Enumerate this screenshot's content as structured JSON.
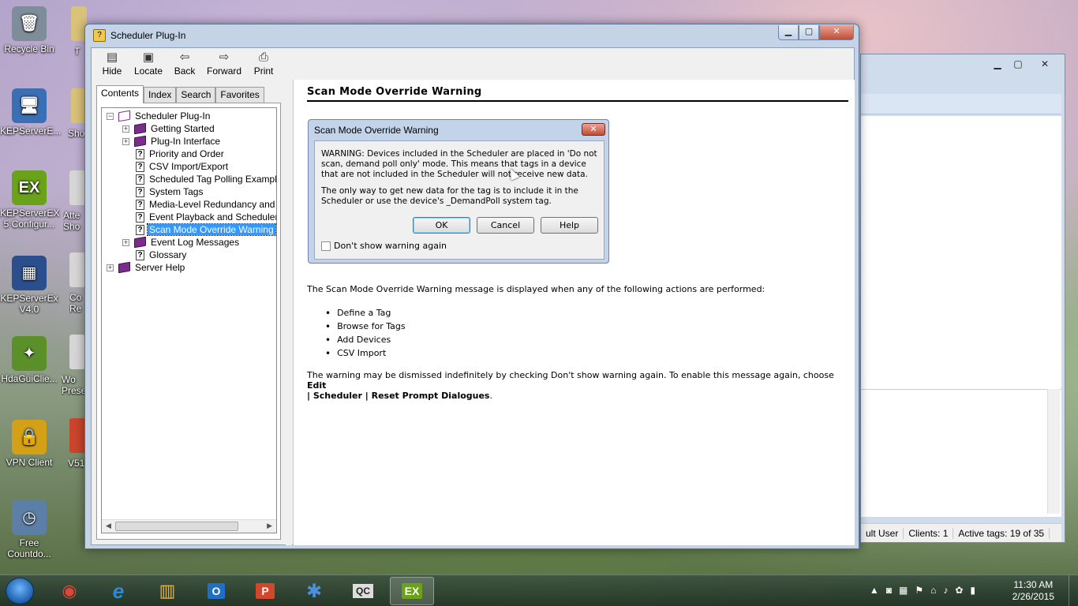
{
  "desktop": {
    "icons": [
      {
        "label": "Recycle Bin",
        "color": "#7f8c99",
        "glyph": "🗑"
      },
      {
        "label": "KEPServerE...",
        "color": "#3b6fb3",
        "glyph": "🖥"
      },
      {
        "label": "KEPServerEX 5 Configur...",
        "color": "#6aa21a",
        "glyph": "EX"
      },
      {
        "label": "KEPServerEx V4.0",
        "color": "#2b4f8c",
        "glyph": "▦"
      },
      {
        "label": "HdaGuiClie...",
        "color": "#5a8f2a",
        "glyph": "✦"
      },
      {
        "label": "VPN Client",
        "color": "#d4a017",
        "glyph": "🔒"
      },
      {
        "label": "Free Countdo...",
        "color": "#5b7fa6",
        "glyph": "◷"
      }
    ],
    "partial_labels": [
      "T",
      "Sho",
      "Atte Sho",
      "Co Re",
      "Wo Prese",
      "V51"
    ]
  },
  "background_window": {
    "status": [
      "ult User",
      "Clients: 1",
      "Active tags: 19 of 35"
    ]
  },
  "help_window": {
    "title": "Scheduler Plug-In",
    "caption": {
      "minimize": "▁",
      "maximize": "▢",
      "close": "✕"
    },
    "toolbar": [
      {
        "label": "Hide",
        "icon": "hide-icon",
        "glyph": "▤"
      },
      {
        "label": "Locate",
        "icon": "locate-icon",
        "glyph": "▣"
      },
      {
        "label": "Back",
        "icon": "back-arrow-icon",
        "glyph": "⇦"
      },
      {
        "label": "Forward",
        "icon": "forward-arrow-icon",
        "glyph": "⇨"
      },
      {
        "label": "Print",
        "icon": "printer-icon",
        "glyph": "⎙"
      }
    ],
    "tabs": [
      "Contents",
      "Index",
      "Search",
      "Favorites"
    ],
    "tree": [
      {
        "label": "Scheduler Plug-In",
        "type": "book-open",
        "expander": "−"
      },
      {
        "label": "Getting Started",
        "type": "book",
        "expander": "+"
      },
      {
        "label": "Plug-In Interface",
        "type": "book",
        "expander": "+"
      },
      {
        "label": "Priority and Order",
        "type": "page"
      },
      {
        "label": "CSV Import/Export",
        "type": "page"
      },
      {
        "label": "Scheduled Tag Polling Examples",
        "type": "page"
      },
      {
        "label": "System Tags",
        "type": "page"
      },
      {
        "label": "Media-Level Redundancy and Sc",
        "type": "page"
      },
      {
        "label": "Event Playback and Scheduler",
        "type": "page"
      },
      {
        "label": "Scan Mode Override Warning",
        "type": "page",
        "selected": true
      },
      {
        "label": "Event Log Messages",
        "type": "book",
        "expander": "+"
      },
      {
        "label": "Glossary",
        "type": "page"
      },
      {
        "label": "Server Help",
        "type": "book",
        "expander": "+"
      }
    ],
    "content": {
      "heading": "Scan Mode Override Warning",
      "dialog": {
        "title": "Scan Mode Override Warning",
        "close": "✕",
        "warning": "WARNING: Devices included in the Scheduler are placed in 'Do not scan, demand poll only' mode. This means that tags in a device that are not included in the Scheduler will not receive new data.",
        "info": "The only way to get new data for the tag is to include it in the Scheduler or use the device's _DemandPoll system tag.",
        "ok": "OK",
        "cancel": "Cancel",
        "help": "Help",
        "checkbox": "Don't show warning again"
      },
      "intro": "The Scan Mode Override Warning message is displayed when any of the following actions are performed:",
      "actions": [
        "Define a Tag",
        "Browse for Tags",
        "Add Devices",
        "CSV Import"
      ],
      "footer_plain": "The warning may be dismissed indefinitely by checking Don't show warning again. To enable this message again, choose ",
      "footer_bold_1": "Edit",
      "footer_bold_2": "| Scheduler | Reset Prompt Dialogues",
      "footer_end": "."
    }
  },
  "taskbar": {
    "apps": [
      {
        "name": "chrome",
        "glyph": "◉",
        "color": "#e0453a"
      },
      {
        "name": "internet-explorer",
        "glyph": "e",
        "color": "#2a8ad4"
      },
      {
        "name": "file-explorer",
        "glyph": "▥",
        "color": "#e6b64a"
      },
      {
        "name": "outlook",
        "glyph": "O",
        "color": "#1f6fc5"
      },
      {
        "name": "powerpoint",
        "glyph": "P",
        "color": "#d2472b"
      },
      {
        "name": "snowflake-app",
        "glyph": "✱",
        "color": "#4a8fe0"
      },
      {
        "name": "qc-app",
        "glyph": "QC",
        "color": "#dddddd"
      },
      {
        "name": "kepserverex",
        "glyph": "EX",
        "color": "#6aa21a"
      }
    ],
    "clock_time": "11:30 AM",
    "clock_date": "2/26/2015"
  }
}
